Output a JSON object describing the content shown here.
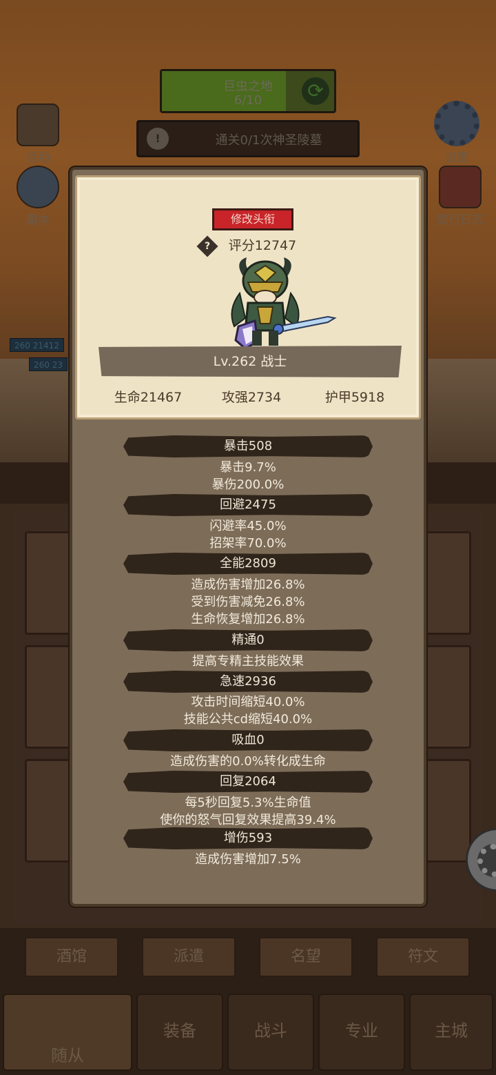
{
  "background": {
    "zone_title": "巨虫之地",
    "zone_progress": "6/10",
    "quest_text": "通关0/1次神圣陵墓",
    "left_buttons": [
      "活动",
      "副本"
    ],
    "right_buttons": [
      "设置",
      "旅行日志"
    ],
    "hp_badges": [
      {
        "level": "260",
        "value": "21412"
      },
      {
        "level": "260",
        "value": "23"
      }
    ],
    "sub_tabs": [
      "酒馆",
      "派遣",
      "名望",
      "符文"
    ],
    "bottom_tabs": [
      "随从",
      "装备",
      "战斗",
      "专业",
      "主城"
    ]
  },
  "hero_card": {
    "rename_label": "修改头衔",
    "score": "评分12747",
    "level_class": "Lv.262 战士",
    "hp": "生命21467",
    "attack": "攻强2734",
    "armor": "护甲5918"
  },
  "stats": [
    {
      "header": "暴击508",
      "lines": [
        "暴击9.7%",
        "暴伤200.0%"
      ]
    },
    {
      "header": "回避2475",
      "lines": [
        "闪避率45.0%",
        "招架率70.0%"
      ]
    },
    {
      "header": "全能2809",
      "lines": [
        "造成伤害增加26.8%",
        "受到伤害减免26.8%",
        "生命恢复增加26.8%"
      ]
    },
    {
      "header": "精通0",
      "lines": [
        "提高专精主技能效果"
      ]
    },
    {
      "header": "急速2936",
      "lines": [
        "攻击时间缩短40.0%",
        "技能公共cd缩短40.0%"
      ]
    },
    {
      "header": "吸血0",
      "lines": [
        "造成伤害的0.0%转化成生命"
      ]
    },
    {
      "header": "回复2064",
      "lines": [
        "每5秒回复5.3%生命值",
        "使你的怒气回复效果提高39.4%"
      ]
    },
    {
      "header": "增伤593",
      "lines": [
        "造成伤害增加7.5%"
      ]
    }
  ]
}
